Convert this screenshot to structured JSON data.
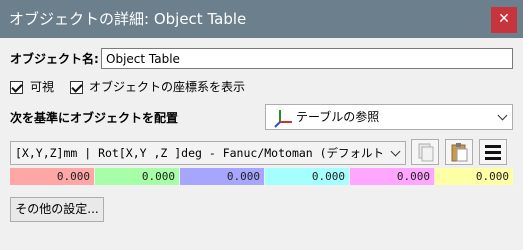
{
  "window": {
    "title": "オブジェクトの詳細: Object Table",
    "close_glyph": "✕"
  },
  "name": {
    "label": "オブジェクト名:",
    "value": "Object Table"
  },
  "checkboxes": {
    "visible_label": "可視",
    "show_frame_label": "オブジェクトの座標系を表示"
  },
  "placement": {
    "label": "次を基準にオブジェクトを配置",
    "reference": "テーブルの参照"
  },
  "pose_format": {
    "text": "[X,Y,Z]mm | Rot[X,Y ,Z  ]deg - Fanuc/Motoman (デフォルト)"
  },
  "pose_values": [
    "0.000",
    "0.000",
    "0.000",
    "0.000",
    "0.000",
    "0.000"
  ],
  "colors": {
    "title_bar": "#6b7f8d",
    "close": "#c8343b",
    "val_x": "#ffa6a6",
    "val_y": "#a6ffa6",
    "val_z": "#a6a6ff",
    "val_rx": "#a6ffff",
    "val_ry": "#ffa6ff",
    "val_rz": "#ffffa6"
  },
  "icons": [
    "axis-icon",
    "copy-icon",
    "paste-icon",
    "menu-icon",
    "close-icon"
  ],
  "other_settings": "その他の設定..."
}
